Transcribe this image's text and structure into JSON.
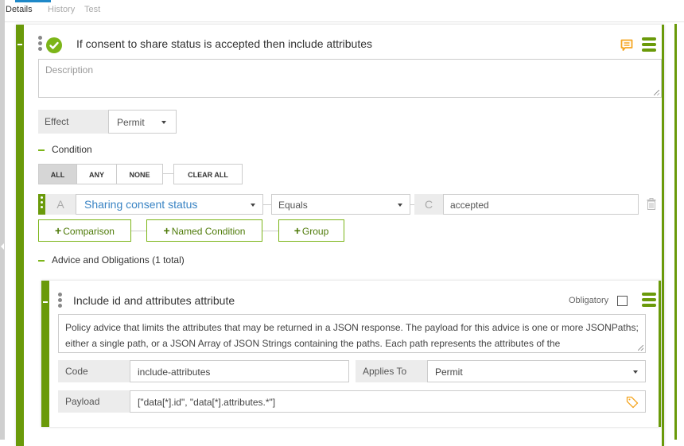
{
  "tabs": [
    {
      "label": "Details",
      "active": true
    },
    {
      "label": "History",
      "active": false
    },
    {
      "label": "Test",
      "active": false
    }
  ],
  "rule": {
    "title": "If consent to share status is accepted then include  attributes",
    "status_icon": "check-circle-icon",
    "description_placeholder": "Description",
    "effect_label": "Effect",
    "effect_value": "Permit",
    "condition": {
      "heading": "Condition",
      "logic_buttons": [
        "ALL",
        "ANY",
        "NONE"
      ],
      "active_logic": "ALL",
      "clear_all_label": "CLEAR ALL",
      "row": {
        "left_letter": "A",
        "attribute": "Sharing consent status",
        "operator": "Equals",
        "right_letter": "C",
        "value": "accepted"
      },
      "add_buttons": [
        "Comparison",
        "Named Condition",
        "Group"
      ]
    },
    "advice_heading": "Advice and Obligations (1 total)"
  },
  "advice": {
    "title": "Include id and attributes attribute",
    "obligatory_label": "Obligatory",
    "obligatory_checked": false,
    "description": "Policy advice that limits the attributes that may be returned in a JSON response. The payload for this advice is one or more JSONPaths; either a single path, or a JSON Array of JSON Strings containing the paths. Each path represents the attributes of the",
    "code_label": "Code",
    "code_value": "include-attributes",
    "applies_to_label": "Applies To",
    "applies_to_value": "Permit",
    "payload_label": "Payload",
    "payload_value": "[\"data[*].id\", \"data[*].attributes.*\"]"
  },
  "colors": {
    "accent_green": "#6a9a0a",
    "check_green": "#7cb518",
    "link_blue": "#3a84c4",
    "tab_active_blue": "#1e88c8",
    "icon_orange": "#f5a623"
  }
}
